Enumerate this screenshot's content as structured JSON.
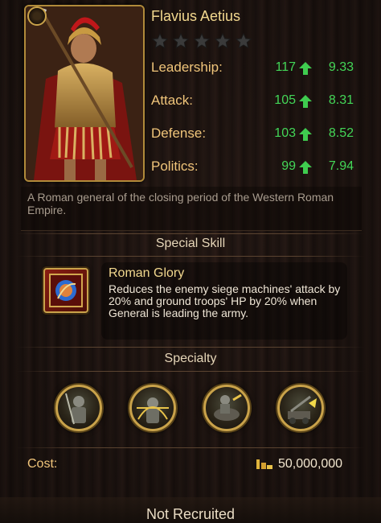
{
  "hero": {
    "name": "Flavius Aetius",
    "stars_total": 5,
    "stars_filled": 0,
    "description": "A Roman general of the closing period of the Western Roman Empire."
  },
  "stats": [
    {
      "label": "Leadership:",
      "value": "117",
      "bonus": "9.33"
    },
    {
      "label": "Attack:",
      "value": "105",
      "bonus": "8.31"
    },
    {
      "label": "Defense:",
      "value": "103",
      "bonus": "8.52"
    },
    {
      "label": "Politics:",
      "value": "99",
      "bonus": "7.94"
    }
  ],
  "special_skill": {
    "section_title": "Special Skill",
    "name": "Roman Glory",
    "description": "Reduces the enemy siege machines' attack by 20% and ground troops' HP by 20% when General is leading the army."
  },
  "specialty": {
    "section_title": "Specialty",
    "icons": [
      "infantry-specialty-icon",
      "ranged-specialty-icon",
      "cavalry-specialty-icon",
      "siege-specialty-icon"
    ]
  },
  "cost": {
    "label": "Cost:",
    "value": "50,000,000",
    "icon": "gold-icon"
  },
  "status": "Not Recruited",
  "colors": {
    "stat_green": "#43d657",
    "gold_text": "#f2d88e",
    "label_orange": "#f0c57a",
    "frame_gold": "#c9a24a"
  }
}
